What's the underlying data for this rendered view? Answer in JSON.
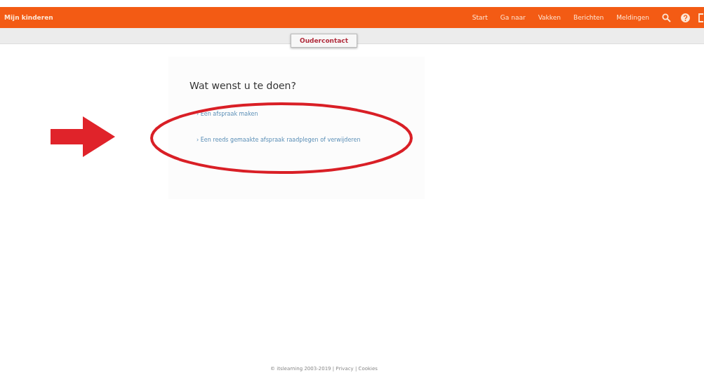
{
  "header": {
    "title": "Mijn kinderen",
    "nav": [
      "Start",
      "Ga naar",
      "Vakken",
      "Berichten",
      "Meldingen"
    ]
  },
  "subbar": {
    "button": "Oudercontact"
  },
  "card": {
    "heading": "Wat wenst u te doen?",
    "links": [
      "› Een afspraak maken",
      "› Een reeds gemaakte afspraak raadplegen of verwijderen"
    ]
  },
  "footer": "© itslearning 2003-2019 | Privacy | Cookies"
}
